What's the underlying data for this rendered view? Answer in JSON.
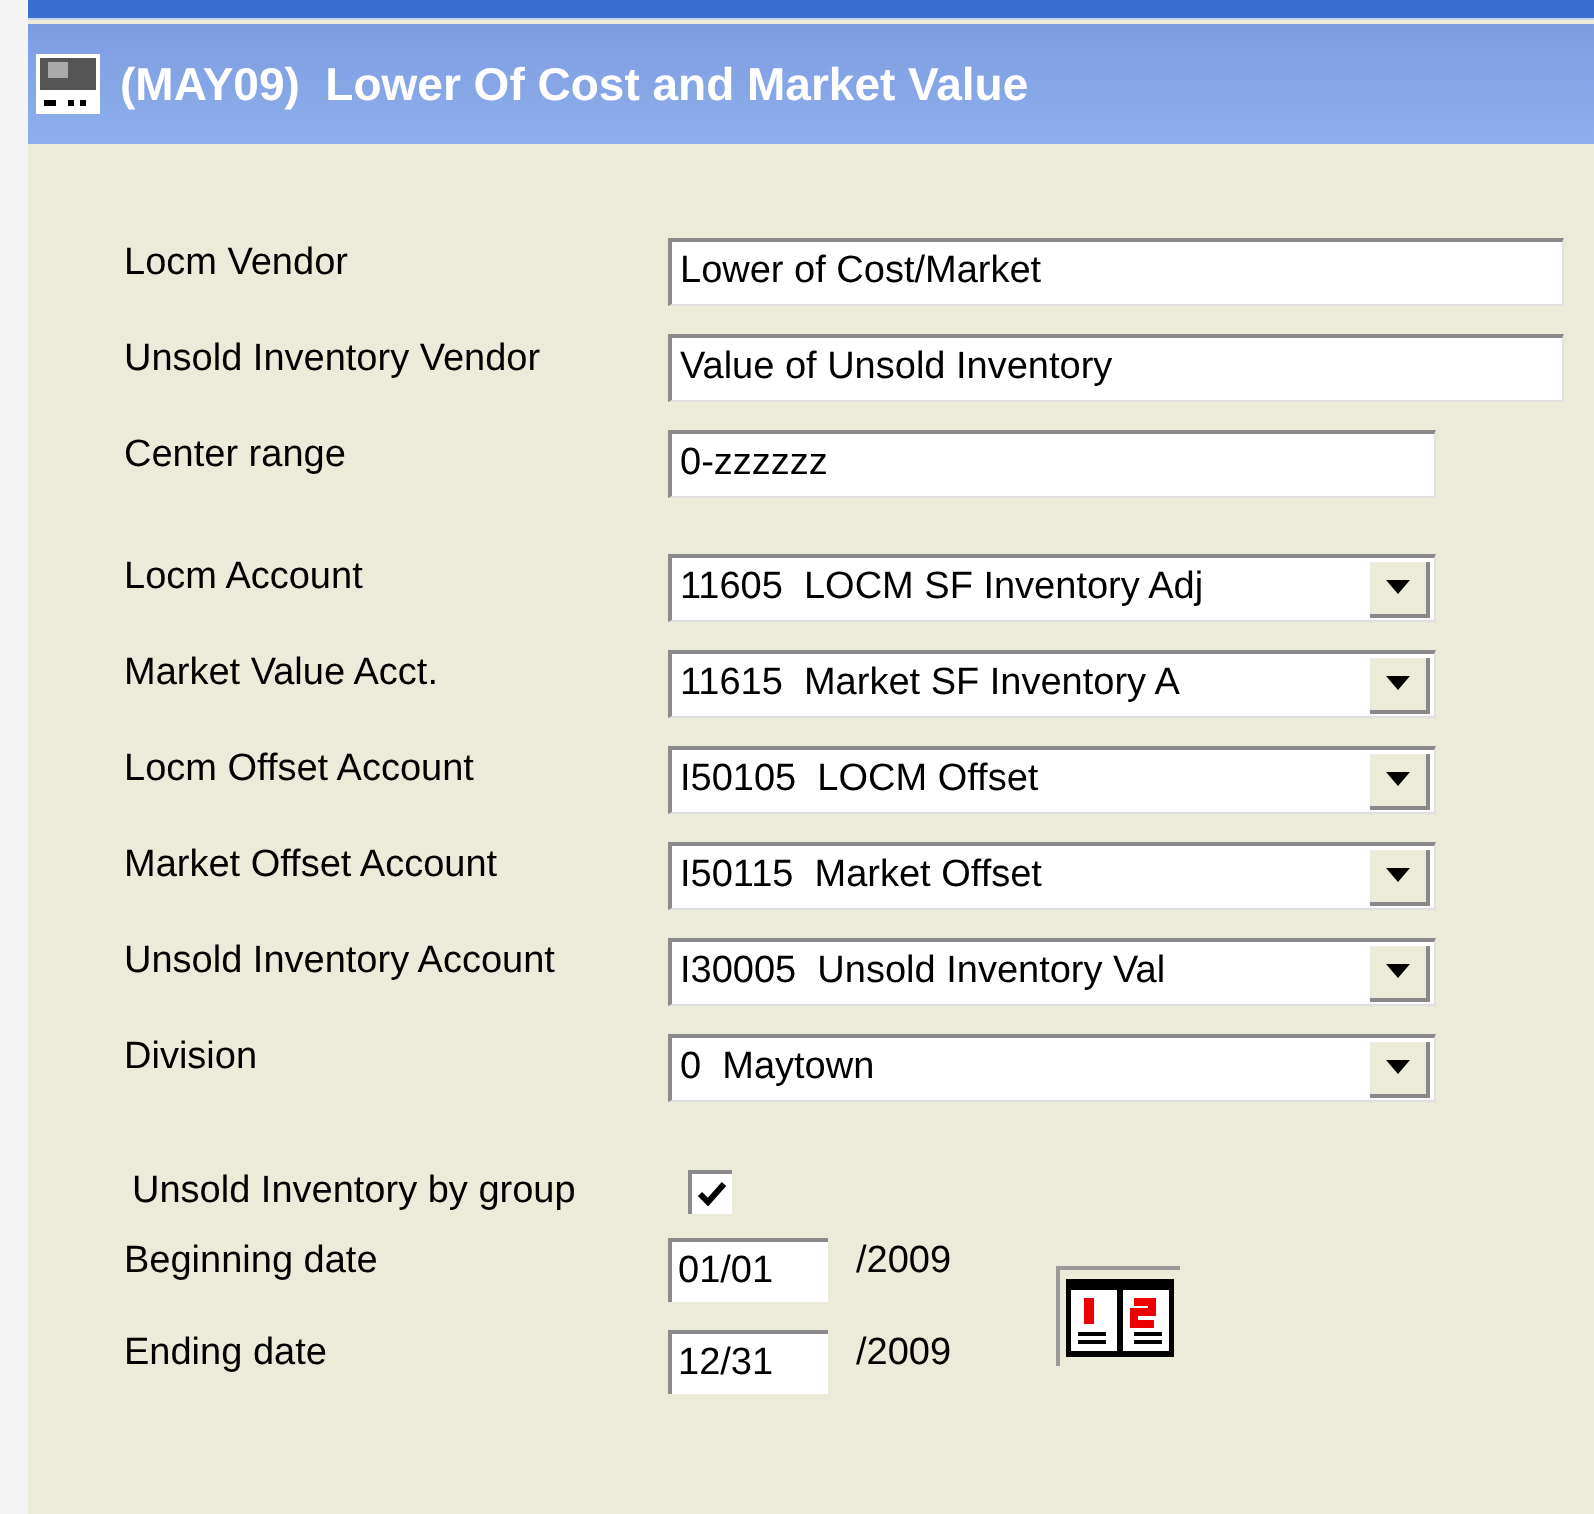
{
  "window": {
    "title": "(MAY09)  Lower Of Cost and Market Value"
  },
  "text_fields": [
    {
      "label": "Locm Vendor",
      "value": "Lower of Cost/Market"
    },
    {
      "label": "Unsold Inventory Vendor",
      "value": "Value of Unsold Inventory"
    },
    {
      "label": "Center range",
      "value": "0-zzzzzz"
    }
  ],
  "dropdowns": [
    {
      "label": "Locm Account",
      "value": "11605  LOCM SF Inventory Adj"
    },
    {
      "label": "Market Value Acct.",
      "value": "11615  Market SF Inventory A"
    },
    {
      "label": "Locm Offset Account",
      "value": "I50105  LOCM Offset"
    },
    {
      "label": "Market Offset Account",
      "value": "I50115  Market Offset"
    },
    {
      "label": "Unsold Inventory Account",
      "value": "I30005  Unsold Inventory Val"
    },
    {
      "label": "Division",
      "value": "0  Maytown"
    }
  ],
  "checkbox": {
    "label": "Unsold Inventory by group",
    "checked": true
  },
  "dates": [
    {
      "label": "Beginning date",
      "value": "01/01",
      "year": "/2009"
    },
    {
      "label": "Ending date",
      "value": "12/31",
      "year": "/2009"
    }
  ]
}
